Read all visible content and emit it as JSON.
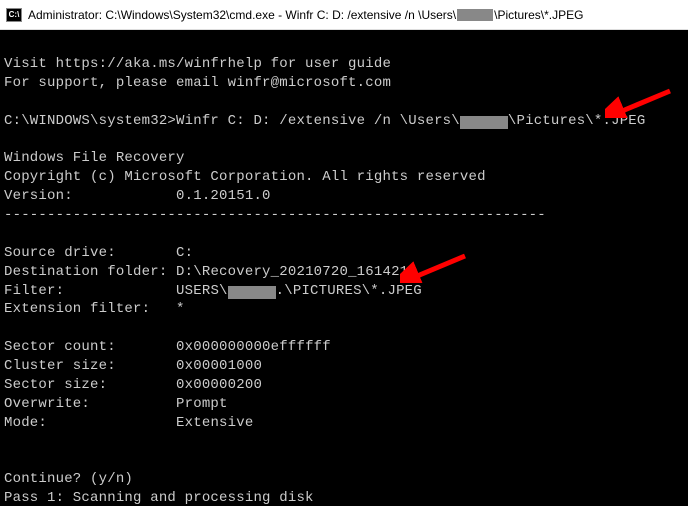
{
  "titlebar": {
    "icon_label": "C:\\",
    "prefix": "Administrator: C:\\Windows\\System32\\cmd.exe - Winfr  C: D: /extensive /n \\Users\\",
    "suffix": "\\Pictures\\*.JPEG"
  },
  "terminal": {
    "help_line1": "Visit https://aka.ms/winfrhelp for user guide",
    "help_line2": "For support, please email winfr@microsoft.com",
    "prompt": "C:\\WINDOWS\\system32>",
    "cmd_before": "Winfr C: D: /extensive /n \\Users\\",
    "cmd_after": "\\Pictures\\*.JPEG",
    "app_name": "Windows File Recovery",
    "copyright": "Copyright (c) Microsoft Corporation. All rights reserved",
    "version_label": "Version:",
    "version_value": "0.1.20151.0",
    "separator": "---------------------------------------------------------------",
    "source_label": "Source drive:",
    "source_value": "C:",
    "dest_label": "Destination folder:",
    "dest_value": "D:\\Recovery_20210720_161421",
    "filter_label": "Filter:",
    "filter_value_before": "USERS\\",
    "filter_value_after": ".\\PICTURES\\*.JPEG",
    "ext_filter_label": "Extension filter:",
    "ext_filter_value": "*",
    "sector_count_label": "Sector count:",
    "sector_count_value": "0x000000000effffff",
    "cluster_size_label": "Cluster size:",
    "cluster_size_value": "0x00001000",
    "sector_size_label": "Sector size:",
    "sector_size_value": "0x00000200",
    "overwrite_label": "Overwrite:",
    "overwrite_value": "Prompt",
    "mode_label": "Mode:",
    "mode_value": "Extensive",
    "continue_prompt": "Continue? (y/n)",
    "pass_line": "Pass 1: Scanning and processing disk"
  },
  "annotations": {
    "arrow_color": "#ff0000"
  }
}
